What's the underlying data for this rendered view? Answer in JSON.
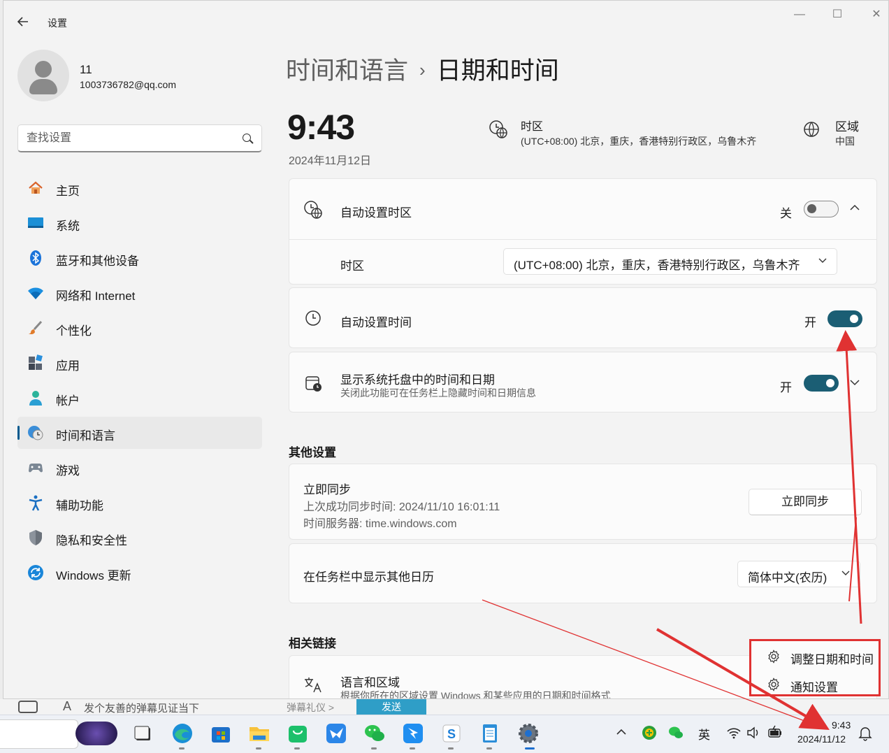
{
  "window": {
    "app_title": "设置",
    "controls": {
      "minimize": "—",
      "maximize": "☐",
      "close": "✕"
    }
  },
  "user": {
    "name": "11",
    "email": "1003736782@qq.com"
  },
  "search": {
    "placeholder": "查找设置"
  },
  "nav": [
    {
      "label": "主页",
      "icon": "home-icon"
    },
    {
      "label": "系统",
      "icon": "system-icon"
    },
    {
      "label": "蓝牙和其他设备",
      "icon": "bluetooth-icon"
    },
    {
      "label": "网络和 Internet",
      "icon": "wifi-icon"
    },
    {
      "label": "个性化",
      "icon": "brush-icon"
    },
    {
      "label": "应用",
      "icon": "apps-icon"
    },
    {
      "label": "帐户",
      "icon": "account-icon"
    },
    {
      "label": "时间和语言",
      "icon": "time-language-icon",
      "active": true
    },
    {
      "label": "游戏",
      "icon": "gamepad-icon"
    },
    {
      "label": "辅助功能",
      "icon": "accessibility-icon"
    },
    {
      "label": "隐私和安全性",
      "icon": "shield-icon"
    },
    {
      "label": "Windows 更新",
      "icon": "update-icon"
    }
  ],
  "breadcrumb": {
    "parent": "时间和语言",
    "separator": "›",
    "current": "日期和时间"
  },
  "summary": {
    "time": "9:43",
    "date": "2024年11月12日",
    "timezone_title": "时区",
    "timezone_value": "(UTC+08:00) 北京，重庆，香港特别行政区，乌鲁木齐",
    "region_title": "区域",
    "region_value": "中国"
  },
  "settings": {
    "auto_timezone": {
      "title": "自动设置时区",
      "state": "关",
      "on": false
    },
    "timezone_row": {
      "label": "时区",
      "value": "(UTC+08:00) 北京，重庆，香港特别行政区，乌鲁木齐"
    },
    "auto_time": {
      "title": "自动设置时间",
      "state": "开",
      "on": true
    },
    "tray_time": {
      "title": "显示系统托盘中的时间和日期",
      "subtitle": "关闭此功能可在任务栏上隐藏时间和日期信息",
      "state": "开",
      "on": true
    }
  },
  "other_settings": {
    "header": "其他设置",
    "sync": {
      "title": "立即同步",
      "last_sync": "上次成功同步时间: 2024/11/10 16:01:11",
      "server": "时间服务器: time.windows.com",
      "button": "立即同步"
    },
    "calendar": {
      "title": "在任务栏中显示其他日历",
      "value": "简体中文(农历)"
    }
  },
  "related": {
    "header": "相关链接",
    "language_region": {
      "title": "语言和区域",
      "subtitle": "根据你所在的区域设置 Windows 和某些应用的日期和时间格式"
    }
  },
  "context_menu": {
    "items": [
      {
        "label": "调整日期和时间",
        "icon": "gear-icon"
      },
      {
        "label": "通知设置",
        "icon": "gear-icon"
      }
    ]
  },
  "background_window": {
    "text": "发个友善的弹幕见证当下",
    "gift": "弹幕礼仪 >",
    "send": "发送",
    "letter": "A"
  },
  "taskbar": {
    "apps": [
      "media-app-icon",
      "terminal-icon",
      "edge-icon",
      "store-icon",
      "file-explorer-icon",
      "bag-app-icon",
      "feishu-icon",
      "wechat-icon",
      "dingtalk-icon",
      "s-app-icon",
      "notepad-icon",
      "settings-icon"
    ],
    "tray": {
      "ime": "英"
    },
    "clock": {
      "time": "9:43",
      "date": "2024/11/12"
    }
  },
  "colors": {
    "accent": "#1b5e74",
    "annotation": "#e03232",
    "nav_indicator": "#005a8e"
  }
}
